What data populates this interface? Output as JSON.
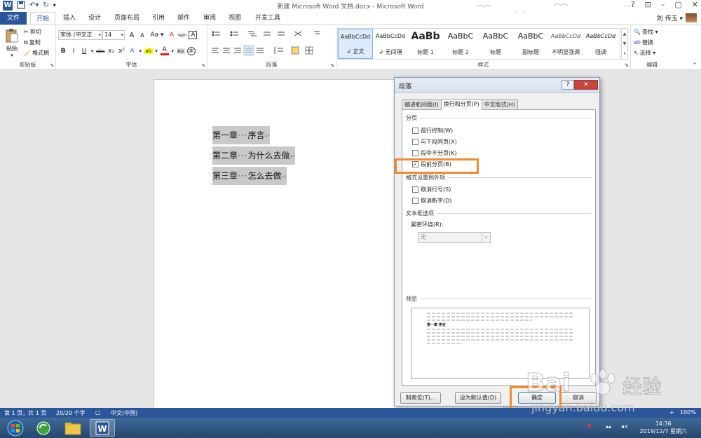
{
  "window": {
    "title": "新建 Microsoft Word 文档.docx - Microsoft Word",
    "buttons": [
      "?",
      "⊡",
      "–",
      "▢",
      "✕"
    ]
  },
  "tabs": {
    "file": "文件",
    "items": [
      "开始",
      "插入",
      "设计",
      "页面布局",
      "引用",
      "邮件",
      "审阅",
      "视图",
      "开发工具"
    ],
    "active": "开始",
    "user": "刘 传玉 ▾"
  },
  "ribbon": {
    "clipboard": {
      "label": "剪贴板",
      "paste": "粘贴",
      "cut": "剪切",
      "copy": "复制",
      "format_painter": "格式刷"
    },
    "font": {
      "label": "字体",
      "name": "宋体 (中文正",
      "size": "14",
      "row1": [
        "A",
        "A",
        "Aa ▾",
        "A",
        "wén",
        "A"
      ],
      "row2": [
        "B",
        "I",
        "U",
        "▾",
        "abc",
        "x₂",
        "x²",
        "A",
        "▾",
        "ab",
        "▾",
        "A",
        "▾",
        "Aa",
        "字"
      ]
    },
    "paragraph": {
      "label": "段落"
    },
    "styles": {
      "label": "样式",
      "items": [
        {
          "sample": "AaBbCcDd",
          "name": "↲ 正文"
        },
        {
          "sample": "AaBbCcDd",
          "name": "↲ 无间隔"
        },
        {
          "sample": "AaBb",
          "name": "标题 1"
        },
        {
          "sample": "AaBbC",
          "name": "标题 2"
        },
        {
          "sample": "AaBbC",
          "name": "标题"
        },
        {
          "sample": "AaBbC",
          "name": "副标题"
        },
        {
          "sample": "AaBbCcDd",
          "name": "不明显强调"
        },
        {
          "sample": "AaBbCcDd",
          "name": "强调"
        }
      ]
    },
    "editing": {
      "label": "编辑",
      "find": "查找 ▾",
      "replace": "替换",
      "select": "选择 ▾"
    }
  },
  "document": {
    "lines": [
      {
        "head": "第一章",
        "dots": "···",
        "text": "序言",
        "mark": "↵"
      },
      {
        "head": "第二章",
        "dots": "···",
        "text": "为什么去做",
        "mark": "↵"
      },
      {
        "head": "第三章",
        "dots": "···",
        "text": "怎么去做",
        "mark": "↵"
      }
    ]
  },
  "dialog": {
    "title": "段落",
    "help": "?",
    "close": "✕",
    "tabs": [
      "缩进和间距(I)",
      "换行和分页(P)",
      "中文版式(H)"
    ],
    "active_tab": "换行和分页(P)",
    "pagination": {
      "label": "分页",
      "widow_control": {
        "label": "孤行控制(W)",
        "checked": false
      },
      "keep_with_next": {
        "label": "与下段同页(X)",
        "checked": false
      },
      "keep_lines_together": {
        "label": "段中不分页(K)",
        "checked": false
      },
      "page_break_before": {
        "label": "段前分页(B)",
        "checked": true
      }
    },
    "exceptions": {
      "label": "格式设置例外项",
      "suppress_line_numbers": {
        "label": "取消行号(S)",
        "checked": false
      },
      "dont_hyphenate": {
        "label": "取消断字(D)",
        "checked": false
      }
    },
    "textbox": {
      "label": "文本框选项",
      "tight_wrap_label": "紧密环绕(R):",
      "tight_wrap_value": "无"
    },
    "preview_label": "预览",
    "preview_text": "第一章  序言",
    "buttons": {
      "tabs": "制表位(T)...",
      "set_default": "设为默认值(D)",
      "ok": "确定",
      "cancel": "取消"
    },
    "check_mark": "✓"
  },
  "status": {
    "page": "第 1 页，共 1 页",
    "words": "20/20 个字",
    "language": "中文(中国)",
    "zoom": "100%",
    "zoom_plus": "+"
  },
  "taskbar": {
    "time": "14:36",
    "date": "2019/12/7 星期六"
  },
  "watermark": {
    "brand": "Bai",
    "brand_cn": "经验",
    "url": "jingyan.baidu.com"
  },
  "colors": {
    "word_blue": "#2b579a",
    "highlight_orange": "#f28a2e",
    "selection_gray": "#c9c9c9"
  }
}
